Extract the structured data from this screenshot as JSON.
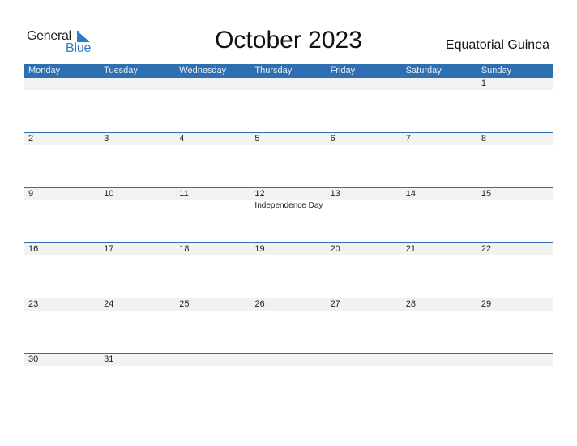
{
  "logo": {
    "word1": "General",
    "word2": "Blue",
    "accent": "#2b7bd0"
  },
  "title": "October 2023",
  "country": "Equatorial Guinea",
  "colors": {
    "header_bg": "#2e6fb2",
    "day_row_bg": "#f2f2f2"
  },
  "weekdays": [
    "Monday",
    "Tuesday",
    "Wednesday",
    "Thursday",
    "Friday",
    "Saturday",
    "Sunday"
  ],
  "weeks": [
    {
      "days": [
        "",
        "",
        "",
        "",
        "",
        "",
        "1"
      ],
      "events": [
        "",
        "",
        "",
        "",
        "",
        "",
        ""
      ]
    },
    {
      "days": [
        "2",
        "3",
        "4",
        "5",
        "6",
        "7",
        "8"
      ],
      "events": [
        "",
        "",
        "",
        "",
        "",
        "",
        ""
      ]
    },
    {
      "days": [
        "9",
        "10",
        "11",
        "12",
        "13",
        "14",
        "15"
      ],
      "events": [
        "",
        "",
        "",
        "Independence Day",
        "",
        "",
        ""
      ]
    },
    {
      "days": [
        "16",
        "17",
        "18",
        "19",
        "20",
        "21",
        "22"
      ],
      "events": [
        "",
        "",
        "",
        "",
        "",
        "",
        ""
      ]
    },
    {
      "days": [
        "23",
        "24",
        "25",
        "26",
        "27",
        "28",
        "29"
      ],
      "events": [
        "",
        "",
        "",
        "",
        "",
        "",
        ""
      ]
    },
    {
      "days": [
        "30",
        "31",
        "",
        "",
        "",
        "",
        ""
      ],
      "events": [
        "",
        "",
        "",
        "",
        "",
        "",
        ""
      ]
    }
  ]
}
